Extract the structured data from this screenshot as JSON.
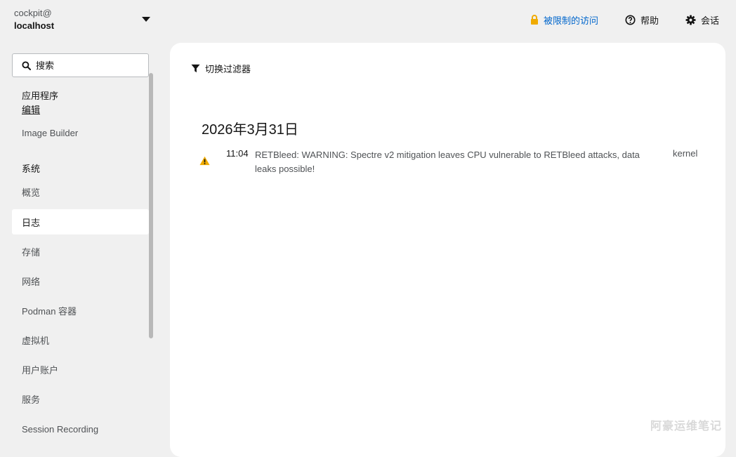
{
  "host": {
    "user": "cockpit@",
    "name": "localhost"
  },
  "topbar": {
    "limited_access": "被限制的访问",
    "help": "帮助",
    "session": "会话"
  },
  "sidebar": {
    "search_placeholder": "搜索",
    "apps_heading": "应用程序",
    "edit_label": "编辑",
    "image_builder": "Image Builder",
    "system_heading": "系统",
    "items": [
      {
        "label": "概览"
      },
      {
        "label": "日志"
      },
      {
        "label": "存储"
      },
      {
        "label": "网络"
      },
      {
        "label": "Podman 容器"
      },
      {
        "label": "虚拟机"
      },
      {
        "label": "用户账户"
      },
      {
        "label": "服务"
      },
      {
        "label": "Session Recording"
      }
    ]
  },
  "main": {
    "filter_toggle": "切换过滤器",
    "date": "2026年3月31日",
    "entries": [
      {
        "time": "11:04",
        "message": "RETBleed: WARNING: Spectre v2 mitigation leaves CPU vulnerable to RETBleed attacks, data leaks possible!",
        "source": "kernel",
        "icon": "warning-icon"
      }
    ]
  },
  "watermark": "阿豪运维笔记",
  "colors": {
    "accent": "#0066cc",
    "warning": "#f0ab00",
    "active_bg": "#ffffff",
    "page_bg": "#f0f0f0"
  }
}
